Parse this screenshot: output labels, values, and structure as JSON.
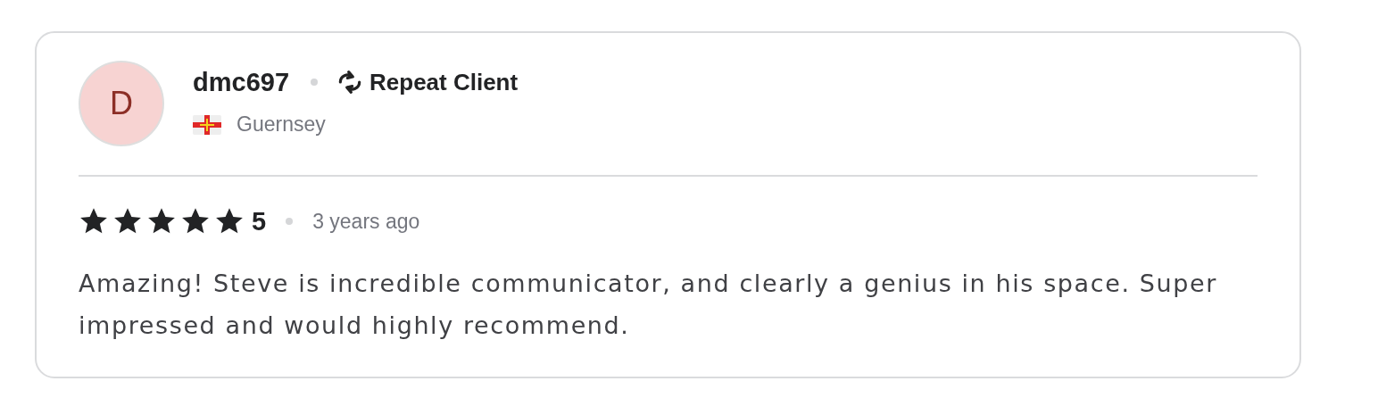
{
  "review": {
    "avatar_letter": "D",
    "username": "dmc697",
    "badge": "Repeat Client",
    "country": "Guernsey",
    "stars": 5,
    "rating": "5",
    "time": "3 years ago",
    "text": "Amazing! Steve is incredible communicator, and clearly a genius in his space. Super impressed and would highly recommend."
  }
}
